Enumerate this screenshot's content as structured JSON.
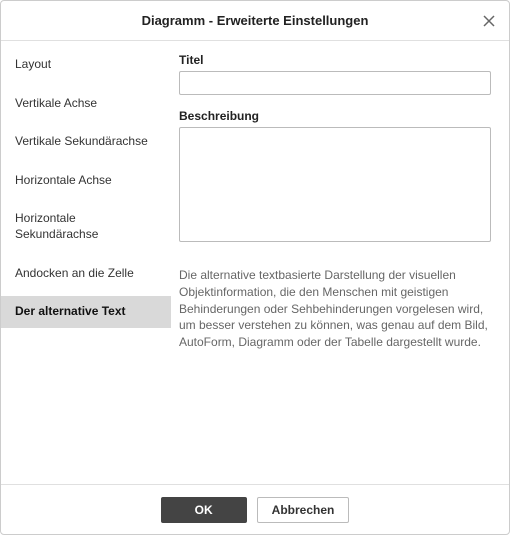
{
  "dialog": {
    "title": "Diagramm - Erweiterte Einstellungen"
  },
  "sidebar": {
    "items": [
      {
        "label": "Layout"
      },
      {
        "label": "Vertikale Achse"
      },
      {
        "label": "Vertikale Sekundärachse"
      },
      {
        "label": "Horizontale Achse"
      },
      {
        "label": "Horizontale Sekundärachse"
      },
      {
        "label": "Andocken an die Zelle"
      },
      {
        "label": "Der alternative Text"
      }
    ],
    "selectedIndex": 6
  },
  "content": {
    "title_label": "Titel",
    "title_value": "",
    "description_label": "Beschreibung",
    "description_value": "",
    "help_text": "Die alternative textbasierte Darstellung der visuellen Objektinformation, die den Menschen mit geistigen Behinderungen oder Sehbehinderungen vorgelesen wird, um besser verstehen zu können, was genau auf dem Bild, AutoForm, Diagramm oder der Tabelle dargestellt wurde."
  },
  "footer": {
    "ok_label": "OK",
    "cancel_label": "Abbrechen"
  }
}
